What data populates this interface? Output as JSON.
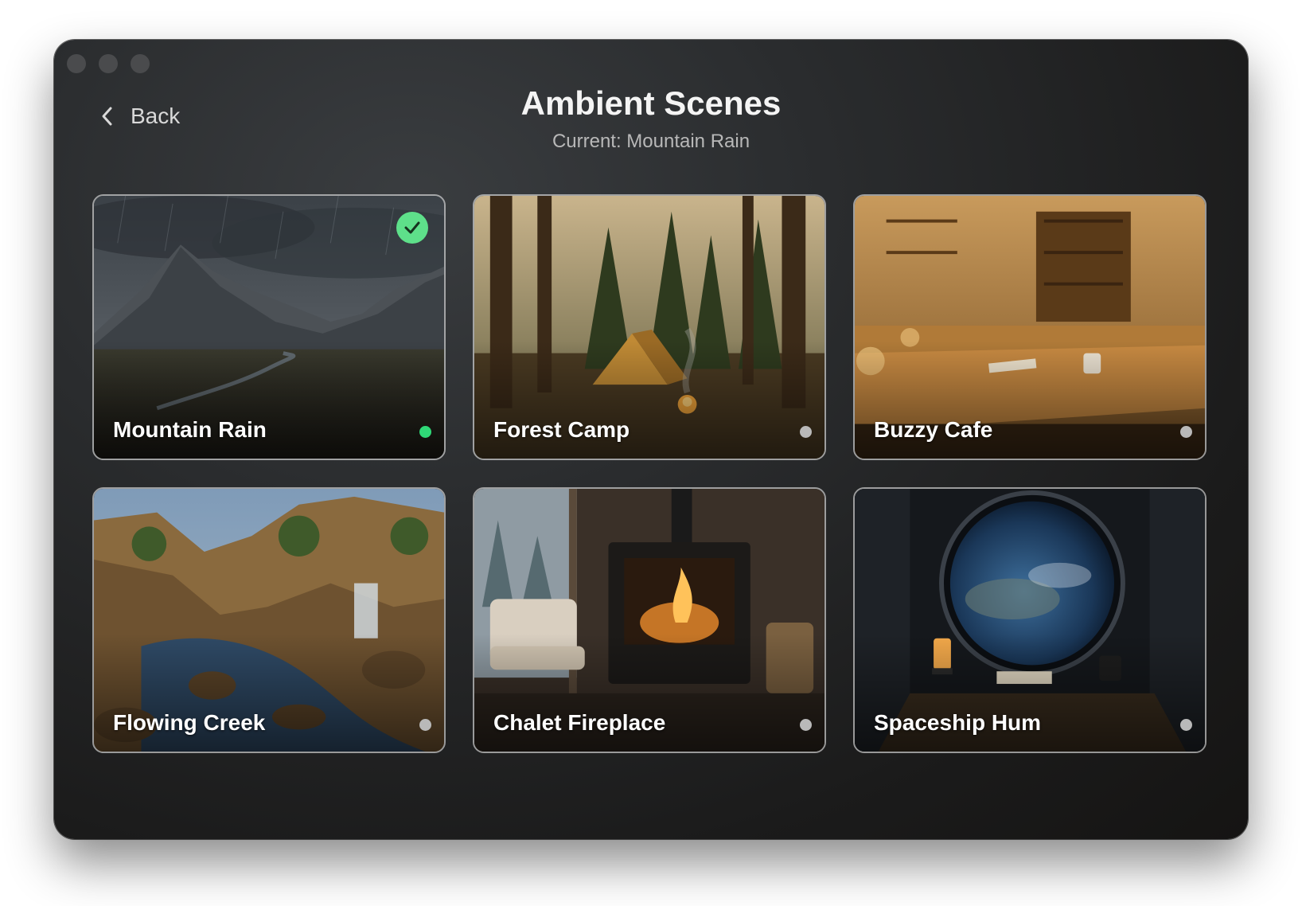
{
  "window": {
    "title": "Ambient Scenes"
  },
  "header": {
    "back_label": "Back",
    "title": "Ambient Scenes",
    "subtitle": "Current: Mountain Rain"
  },
  "colors": {
    "active_indicator": "#2fd877",
    "inactive_indicator": "#b9b9b9",
    "check_badge": "#5ee08a"
  },
  "scenes": [
    {
      "name": "Mountain Rain",
      "selected": true,
      "status": "active"
    },
    {
      "name": "Forest Camp",
      "selected": false,
      "status": "inactive"
    },
    {
      "name": "Buzzy Cafe",
      "selected": false,
      "status": "inactive"
    },
    {
      "name": "Flowing Creek",
      "selected": false,
      "status": "inactive"
    },
    {
      "name": "Chalet Fireplace",
      "selected": false,
      "status": "inactive"
    },
    {
      "name": "Spaceship Hum",
      "selected": false,
      "status": "inactive"
    }
  ]
}
